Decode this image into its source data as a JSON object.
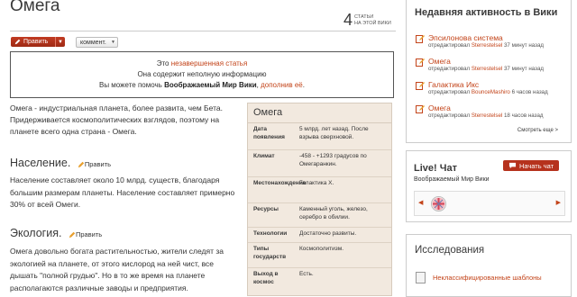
{
  "article": {
    "title": "Омега",
    "counter": {
      "number": "4",
      "label_line1": "статьи",
      "label_line2": "на этой вики"
    },
    "edit_label": "Править",
    "comment_label": "коммент.",
    "stub": {
      "line1_prefix": "Это ",
      "line1_link": "незавершенная статья",
      "line2": "Она содержит неполную информацию",
      "line3_prefix": "Вы можете помочь ",
      "line3_bold": "Воображаемый Мир Вики",
      "line3_mid": ", ",
      "line3_link": "дополнив её",
      "line3_end": "."
    },
    "lead": "Омега - индустриальная планета, более развита, чем Бета. Придерживается космополитических взглядов, поэтому на планете всего одна страна - Омега.",
    "sections": [
      {
        "heading": "Население.",
        "edit": "Править",
        "text": "Население составляет около 10 млрд. существ, благодаря большим размерам планеты. Население составляет примерно 30% от всей Омеги."
      },
      {
        "heading": "Экология.",
        "edit": "Править",
        "text": "Омега довольно богата растительностью, жители следят за экологией на планете, от этого кислород на ней чист, все дышать \"полной грудью\". Но в то же время на планете располагаются различные заводы и предприятия."
      }
    ]
  },
  "infobox": {
    "title": "Омега",
    "rows": [
      {
        "key": "Дата появления",
        "value": "5 млрд. лет назад. После взрыва сверхновой."
      },
      {
        "key": "Климат",
        "value": "-458 - +1293 градусов по Омегаранкин."
      },
      {
        "key": "Местонахождение",
        "value": "Галактика Х."
      },
      {
        "key": "Ресурсы",
        "value": "Каменный уголь, железо, серебро в обилии."
      },
      {
        "key": "Технологии",
        "value": "Достаточно развиты."
      },
      {
        "key": "Типы государств",
        "value": "Космополитизм."
      },
      {
        "key": "Выход в космос",
        "value": "Есть."
      }
    ]
  },
  "activity": {
    "title": "Недавняя активность в Вики",
    "items": [
      {
        "article": "Эпсилонова система",
        "prefix": "отредактировал ",
        "user": "Sterrestelsel",
        "time": " 37 минут назад"
      },
      {
        "article": "Омега",
        "prefix": "отредактировал ",
        "user": "Sterrestelsel",
        "time": " 37 минут назад"
      },
      {
        "article": "Галактика Икс",
        "prefix": "отредактировал ",
        "user": "BounceMashiro",
        "time": " 6 часов назад"
      },
      {
        "article": "Омега",
        "prefix": "отредактировал ",
        "user": "Sterrestelsel",
        "time": " 18 часов назад"
      }
    ],
    "more": "Смотреть еще >"
  },
  "chat": {
    "title": "Live! Чат",
    "button": "Начать чат",
    "wiki": "Воображаемый Мир Вики"
  },
  "research": {
    "title": "Исследования",
    "item": "Неклассифицированные шаблоны"
  },
  "colors": {
    "accent": "#c3441a",
    "button": "#b6321d",
    "infobox_bg": "#f2e9df"
  }
}
